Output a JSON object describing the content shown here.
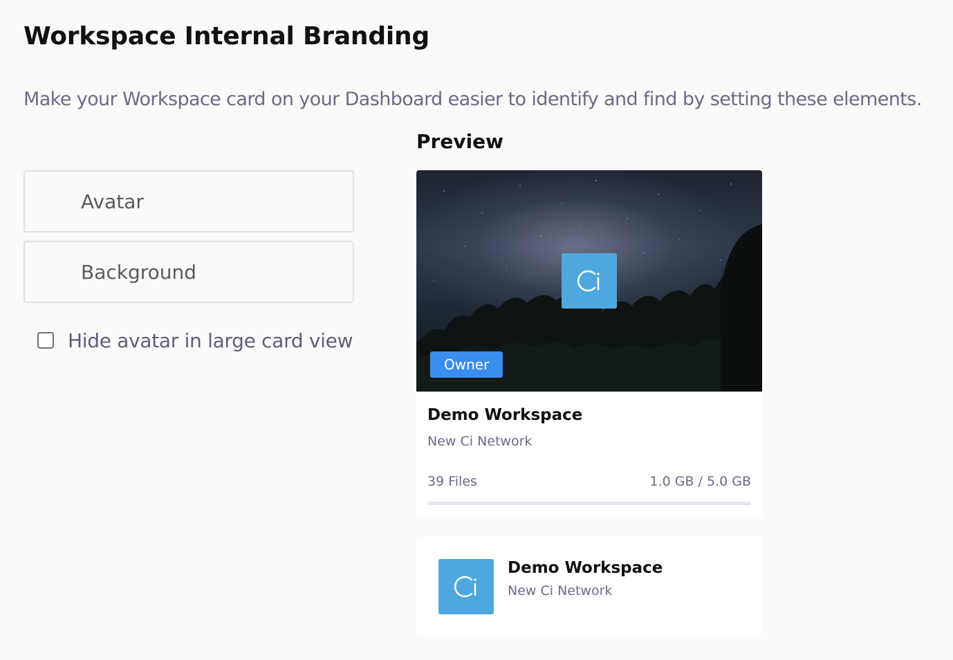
{
  "header": {
    "title": "Workspace Internal Branding",
    "description": "Make your Workspace card on your Dashboard easier to identify and find by setting these elements."
  },
  "options": {
    "avatar_label": "Avatar",
    "background_label": "Background",
    "hide_avatar_label": "Hide avatar in large card view",
    "hide_avatar_checked": false
  },
  "preview": {
    "title": "Preview",
    "large_card": {
      "logo_text": "Ci",
      "badge": "Owner",
      "name": "Demo Workspace",
      "organization": "New Ci Network",
      "files": "39 Files",
      "storage": "1.0 GB / 5.0 GB",
      "storage_used_fraction": 0.2
    },
    "small_card": {
      "logo_text": "Ci",
      "name": "Demo Workspace",
      "organization": "New Ci Network"
    }
  },
  "colors": {
    "logo_bg": "#4ea8dd",
    "badge_bg": "#3a8ef0",
    "muted_text": "#6c6a86"
  }
}
